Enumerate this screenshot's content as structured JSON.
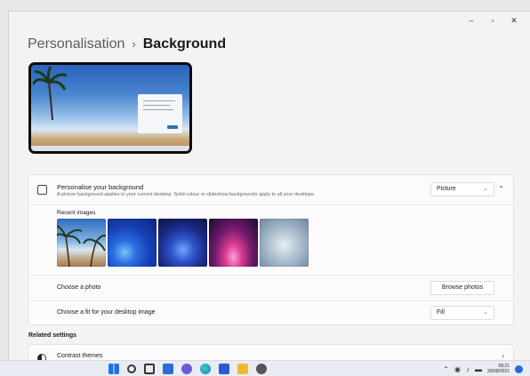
{
  "window": {
    "controls": {
      "minimize": "–",
      "maximize": "▫",
      "close": "✕"
    }
  },
  "breadcrumb": {
    "parent": "Personalisation",
    "separator": "›",
    "current": "Background"
  },
  "background_section": {
    "title": "Personalise your background",
    "description": "A picture background applies to your current desktop. Solid colour or slideshow backgrounds apply to all your desktops.",
    "type_select": {
      "value": "Picture"
    },
    "recent_images_label": "Recent images",
    "recent_images": [
      {
        "name": "beach-palms"
      },
      {
        "name": "blue-bloom-1"
      },
      {
        "name": "blue-bloom-2"
      },
      {
        "name": "purple-glow"
      },
      {
        "name": "white-bloom"
      }
    ],
    "choose_photo_label": "Choose a photo",
    "browse_button": "Browse photos",
    "fit_label": "Choose a fit for your desktop image",
    "fit_select": {
      "value": "Fill"
    }
  },
  "related": {
    "title": "Related settings",
    "contrast_themes": "Contrast themes"
  },
  "taskbar": {
    "icons": [
      "windows-start-icon",
      "search-icon",
      "task-view-icon",
      "widgets-icon",
      "chat-icon",
      "edge-icon",
      "store-icon",
      "file-explorer-icon",
      "settings-icon"
    ],
    "icon_colors": [
      "#1a73e8",
      "#333333",
      "#333333",
      "#2b6cd6",
      "#6b5bd6",
      "#2a9bd3",
      "#2a5bd3",
      "#f2b72c",
      "#555555"
    ],
    "time": "09:21",
    "date": "20/09/2021"
  }
}
